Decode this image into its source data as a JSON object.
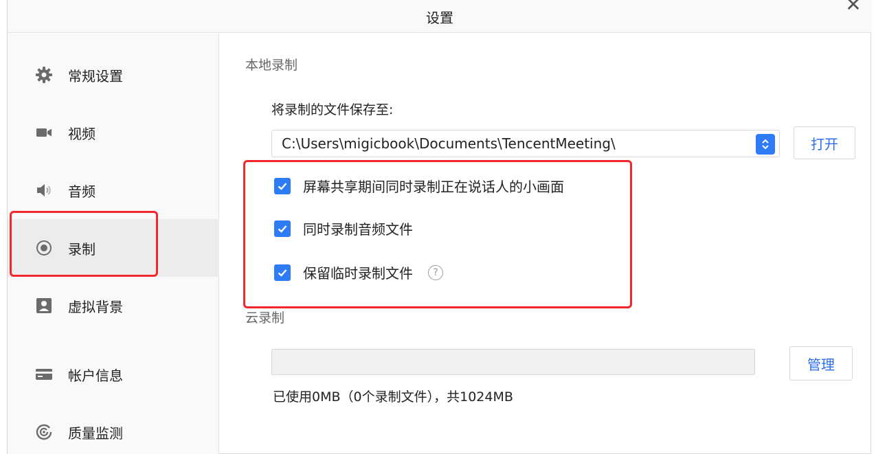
{
  "window": {
    "title": "设置",
    "close_glyph": "✕"
  },
  "sidebar": {
    "items": [
      {
        "label": "常规设置",
        "icon": "gear-icon",
        "active": false
      },
      {
        "label": "视频",
        "icon": "video-camera-icon",
        "active": false
      },
      {
        "label": "音频",
        "icon": "speaker-icon",
        "active": false
      },
      {
        "label": "录制",
        "icon": "record-icon",
        "active": true
      },
      {
        "label": "虚拟背景",
        "icon": "person-portrait-icon",
        "active": false
      },
      {
        "label": "帐户信息",
        "icon": "card-icon",
        "active": false
      },
      {
        "label": "质量监测",
        "icon": "gauge-icon",
        "active": false
      }
    ]
  },
  "local_recording": {
    "section_title": "本地录制",
    "save_to_label": "将录制的文件保存至:",
    "path_value": "C:\\Users\\migicbook\\Documents\\TencentMeeting\\",
    "open_button": "打开",
    "options": [
      {
        "label": "屏幕共享期间同时录制正在说话人的小画面",
        "checked": true,
        "help": false
      },
      {
        "label": "同时录制音频文件",
        "checked": true,
        "help": false
      },
      {
        "label": "保留临时录制文件",
        "checked": true,
        "help": true
      }
    ],
    "help_glyph": "?"
  },
  "cloud_recording": {
    "section_title": "云录制",
    "manage_button": "管理",
    "usage_text": "已使用0MB（0个录制文件），共1024MB"
  },
  "colors": {
    "accent": "#2d7cf6",
    "highlight_red": "#f0282d",
    "sidebar_bg": "#f9f9f9",
    "sidebar_active_bg": "#ececec"
  }
}
